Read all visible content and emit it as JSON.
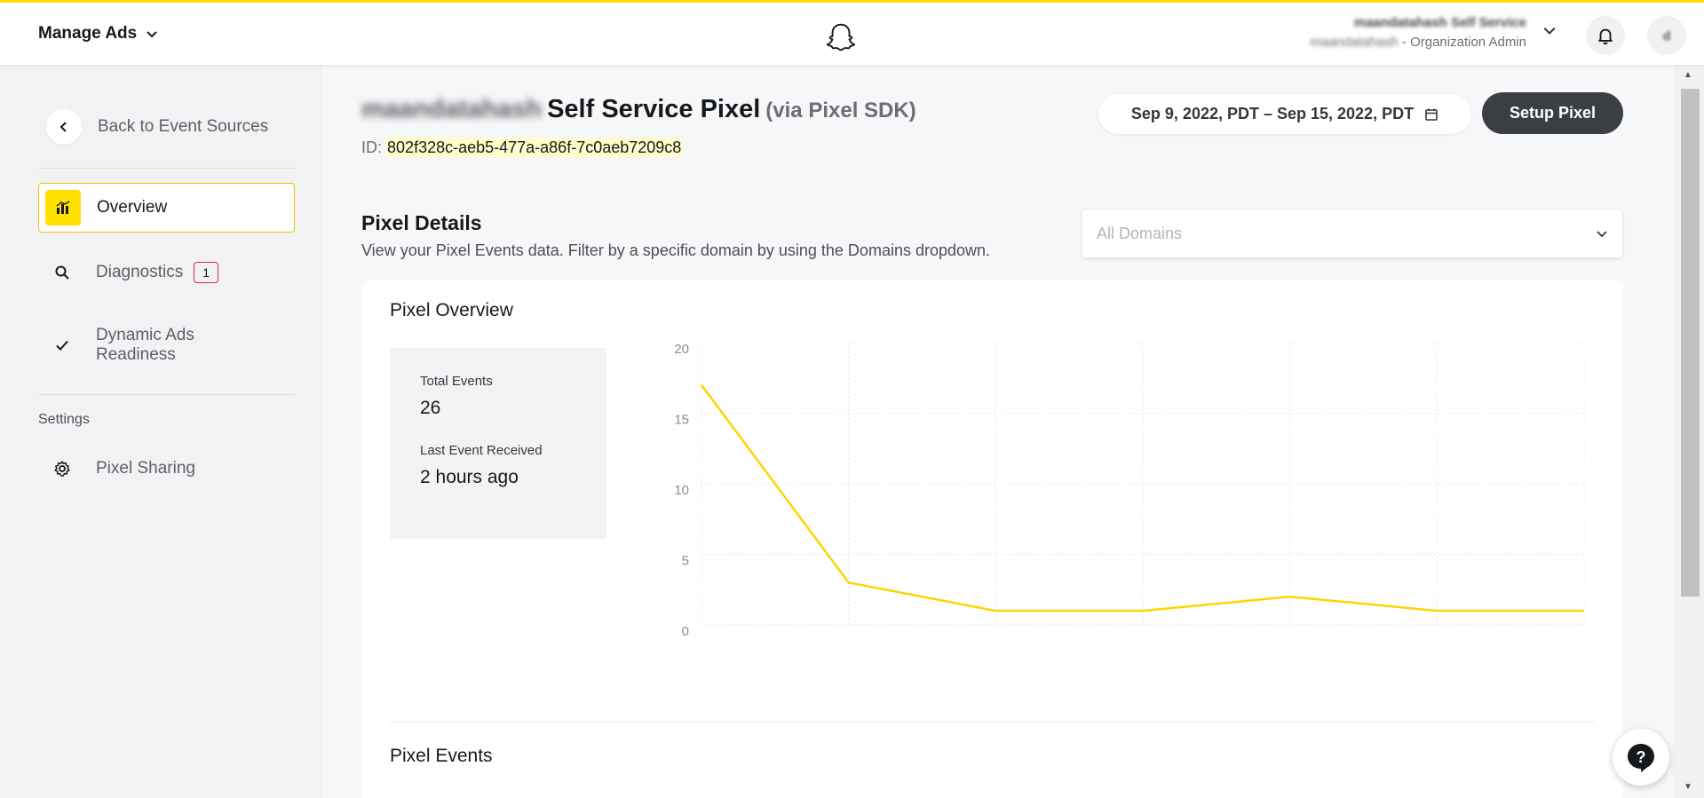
{
  "topbar": {
    "app_label": "Manage Ads",
    "account_name": "maandatahash Self Service",
    "account_org": "maandatahash",
    "account_role": " - Organization Admin",
    "avatar_initial": "d"
  },
  "sidebar": {
    "back_label": "Back to Event Sources",
    "items": [
      {
        "label": "Overview",
        "icon": "chart-icon",
        "active": true
      },
      {
        "label": "Diagnostics",
        "icon": "search-icon",
        "badge": "1"
      },
      {
        "label": "Dynamic Ads Readiness",
        "icon": "check-icon"
      }
    ],
    "settings_heading": "Settings",
    "settings_items": [
      {
        "label": "Pixel Sharing",
        "icon": "gear-icon"
      }
    ]
  },
  "header": {
    "title_name": "maandatahash",
    "title": "Self Service Pixel",
    "title_suffix": "(via Pixel SDK)",
    "id_label": "ID:",
    "id_value": "802f328c-aeb5-477a-a86f-7c0aeb7209c8",
    "date_range": "Sep 9, 2022, PDT – Sep 15, 2022, PDT",
    "setup_label": "Setup Pixel"
  },
  "details": {
    "title": "Pixel Details",
    "subtitle": "View your Pixel Events data. Filter by a specific domain by using the Domains dropdown.",
    "domains_placeholder": "All Domains"
  },
  "overview": {
    "title": "Pixel Overview",
    "total_events_label": "Total Events",
    "total_events_value": "26",
    "last_event_label": "Last Event Received",
    "last_event_value": "2 hours ago",
    "events_title": "Pixel Events"
  },
  "chart_data": {
    "type": "line",
    "x": [
      1,
      2,
      3,
      4,
      5,
      6,
      7
    ],
    "series": [
      {
        "values": [
          17,
          3,
          1,
          1,
          2,
          1,
          1
        ],
        "color": "#ffd400"
      }
    ],
    "yticks": [
      "20",
      "15",
      "10",
      "5",
      "0"
    ],
    "ylim": [
      0,
      20
    ],
    "grid": true
  },
  "colors": {
    "accent": "#ffe000",
    "button_dark": "#3b3f44",
    "badge_border": "#e1264a"
  }
}
